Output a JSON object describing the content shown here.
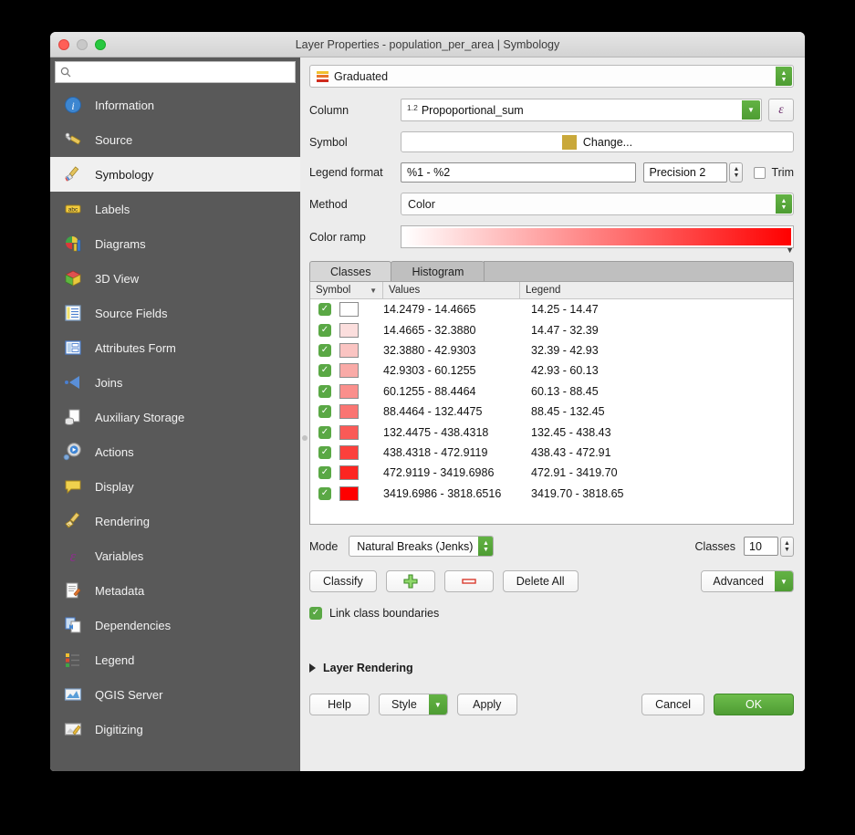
{
  "window": {
    "title": "Layer Properties - population_per_area | Symbology",
    "traffic": {
      "close": "close-button",
      "minimize": "minimize-button",
      "zoom": "zoom-button"
    }
  },
  "sidebar": {
    "search": {
      "value": "",
      "placeholder": ""
    },
    "items": [
      {
        "label": "Information",
        "icon": "information-icon"
      },
      {
        "label": "Source",
        "icon": "source-icon"
      },
      {
        "label": "Symbology",
        "icon": "symbology-icon",
        "selected": true
      },
      {
        "label": "Labels",
        "icon": "labels-icon"
      },
      {
        "label": "Diagrams",
        "icon": "diagrams-icon"
      },
      {
        "label": "3D View",
        "icon": "3d-view-icon"
      },
      {
        "label": "Source Fields",
        "icon": "source-fields-icon"
      },
      {
        "label": "Attributes Form",
        "icon": "attributes-form-icon"
      },
      {
        "label": "Joins",
        "icon": "joins-icon"
      },
      {
        "label": "Auxiliary Storage",
        "icon": "auxiliary-storage-icon"
      },
      {
        "label": "Actions",
        "icon": "actions-icon"
      },
      {
        "label": "Display",
        "icon": "display-icon"
      },
      {
        "label": "Rendering",
        "icon": "rendering-icon"
      },
      {
        "label": "Variables",
        "icon": "variables-icon"
      },
      {
        "label": "Metadata",
        "icon": "metadata-icon"
      },
      {
        "label": "Dependencies",
        "icon": "dependencies-icon"
      },
      {
        "label": "Legend",
        "icon": "legend-icon"
      },
      {
        "label": "QGIS Server",
        "icon": "qgis-server-icon"
      },
      {
        "label": "Digitizing",
        "icon": "digitizing-icon"
      }
    ]
  },
  "symbology": {
    "renderer": "Graduated",
    "column_label": "Column",
    "column_value": "Propoportional_sum",
    "column_type_prefix": "1.2",
    "expression_button": "ε",
    "symbol_label": "Symbol",
    "symbol_change": "Change...",
    "symbol_color": "#c9a83a",
    "legend_format_label": "Legend format",
    "legend_format_value": "%1 - %2",
    "precision_value": "Precision 2",
    "trim_label": "Trim",
    "trim_checked": false,
    "method_label": "Method",
    "method_value": "Color",
    "color_ramp_label": "Color ramp",
    "color_ramp_start": "#ffffff",
    "color_ramp_end": "#ff0000",
    "tabs": [
      {
        "label": "Classes",
        "selected": true
      },
      {
        "label": "Histogram",
        "selected": false
      }
    ],
    "table": {
      "headers": [
        "Symbol",
        "Values",
        "Legend"
      ],
      "rows": [
        {
          "checked": true,
          "color": "#ffffff",
          "values": "14.2479 - 14.4665",
          "legend": "14.25 - 14.47"
        },
        {
          "checked": true,
          "color": "#fbdedd",
          "values": "14.4665 - 32.3880",
          "legend": "14.47 - 32.39"
        },
        {
          "checked": true,
          "color": "#fac4c2",
          "values": "32.3880 - 42.9303",
          "legend": "32.39 - 42.93"
        },
        {
          "checked": true,
          "color": "#f9aaa7",
          "values": "42.9303 - 60.1255",
          "legend": "42.93 - 60.13"
        },
        {
          "checked": true,
          "color": "#fa8f8c",
          "values": "60.1255 - 88.4464",
          "legend": "60.13 - 88.45"
        },
        {
          "checked": true,
          "color": "#fa7572",
          "values": "88.4464 - 132.4475",
          "legend": "88.45 - 132.45"
        },
        {
          "checked": true,
          "color": "#fa5a57",
          "values": "132.4475 - 438.4318",
          "legend": "132.45 - 438.43"
        },
        {
          "checked": true,
          "color": "#fb403c",
          "values": "438.4318 - 472.9119",
          "legend": "438.43 - 472.91"
        },
        {
          "checked": true,
          "color": "#fd2521",
          "values": "472.9119 - 3419.6986",
          "legend": "472.91 - 3419.70"
        },
        {
          "checked": true,
          "color": "#ff0000",
          "values": "3419.6986 - 3818.6516",
          "legend": "3419.70 - 3818.65"
        }
      ]
    },
    "mode_label": "Mode",
    "mode_value": "Natural Breaks (Jenks)",
    "classes_label": "Classes",
    "classes_value": "10",
    "buttons": {
      "classify": "Classify",
      "add_class": "add-class-icon",
      "delete_class": "delete-class-icon",
      "delete_all": "Delete All",
      "advanced": "Advanced"
    },
    "link_class_boundaries_label": "Link class boundaries",
    "link_class_boundaries_checked": true,
    "layer_rendering_label": "Layer Rendering"
  },
  "dialog_buttons": {
    "help": "Help",
    "style": "Style",
    "apply": "Apply",
    "cancel": "Cancel",
    "ok": "OK"
  }
}
